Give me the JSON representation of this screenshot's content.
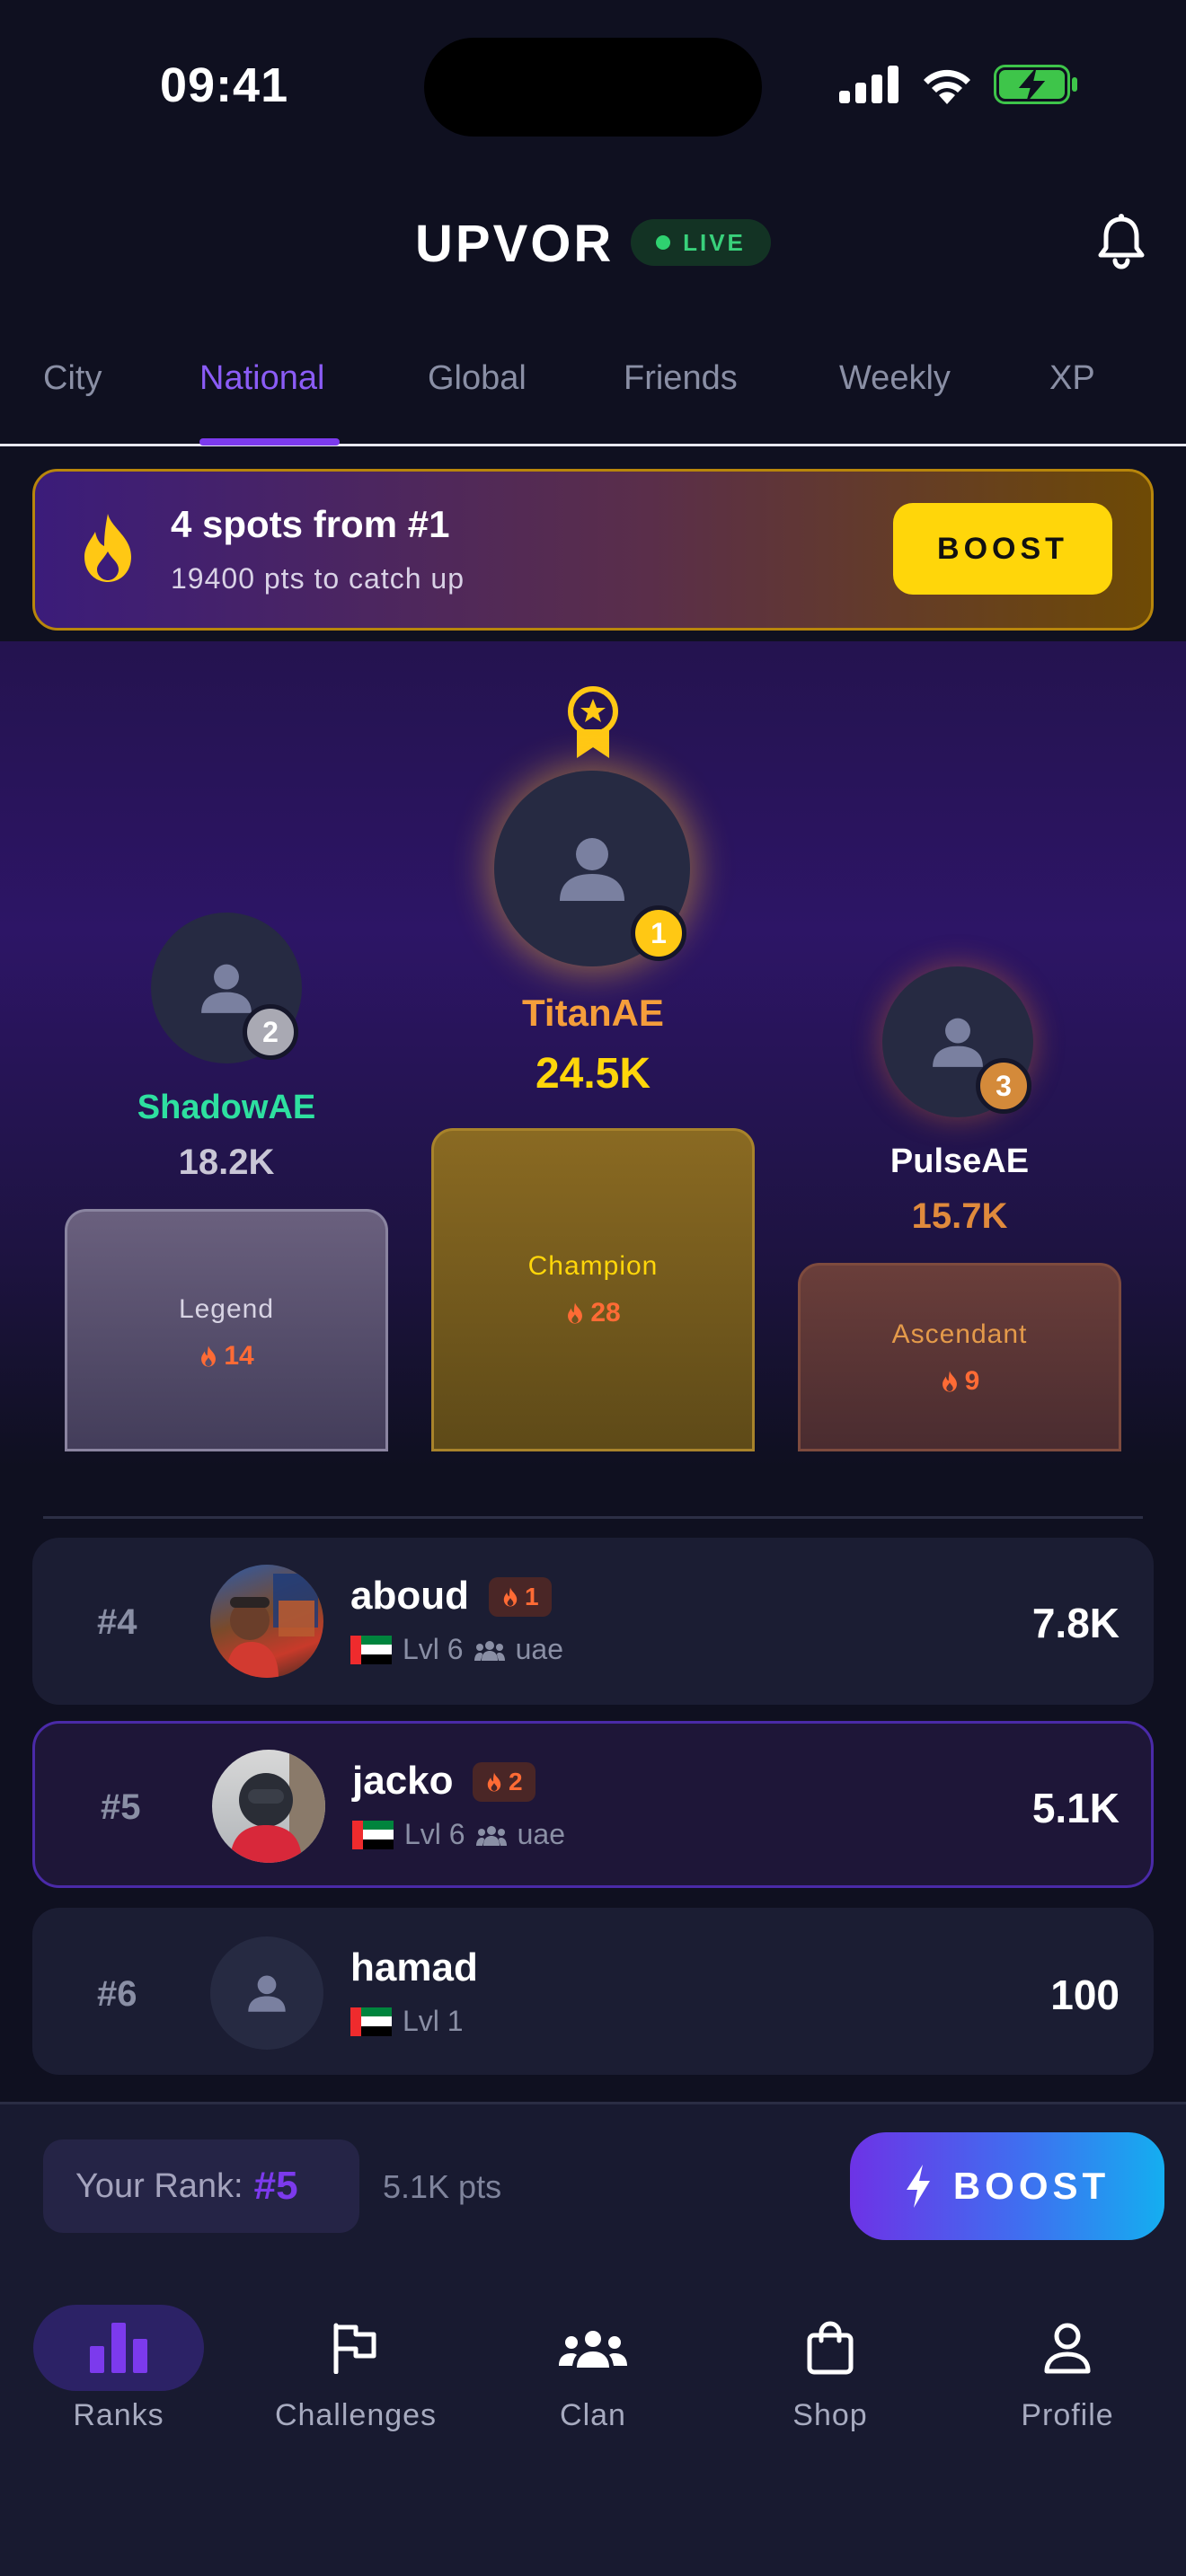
{
  "status": {
    "time": "09:41"
  },
  "header": {
    "title": "UPVOR",
    "live": "LIVE"
  },
  "tabs": [
    "City",
    "National",
    "Global",
    "Friends",
    "Weekly",
    "XP"
  ],
  "active_tab": "National",
  "banner": {
    "title": "4 spots from #1",
    "subtitle": "19400 pts to catch up",
    "button": "BOOST"
  },
  "podium": {
    "first": {
      "rank": "1",
      "name": "TitanAE",
      "score": "24.5K",
      "tier": "Champion",
      "streak": "28"
    },
    "second": {
      "rank": "2",
      "name": "ShadowAE",
      "score": "18.2K",
      "tier": "Legend",
      "streak": "14"
    },
    "third": {
      "rank": "3",
      "name": "PulseAE",
      "score": "15.7K",
      "tier": "Ascendant",
      "streak": "9"
    }
  },
  "list": [
    {
      "rank": "#4",
      "name": "aboud",
      "streak": "1",
      "level": "Lvl 6",
      "clan": "uae",
      "score": "7.8K"
    },
    {
      "rank": "#5",
      "name": "jacko",
      "streak": "2",
      "level": "Lvl 6",
      "clan": "uae",
      "score": "5.1K"
    },
    {
      "rank": "#6",
      "name": "hamad",
      "level": "Lvl 1",
      "score": "100"
    }
  ],
  "footer": {
    "your_rank_label": "Your Rank:",
    "your_rank": "#5",
    "points": "5.1K pts",
    "boost": "BOOST"
  },
  "nav": [
    "Ranks",
    "Challenges",
    "Clan",
    "Shop",
    "Profile"
  ],
  "colors": {
    "accent": "#7c3aed",
    "gold": "#ffd60a",
    "streak": "#ff6b35",
    "live": "#2fd170"
  }
}
